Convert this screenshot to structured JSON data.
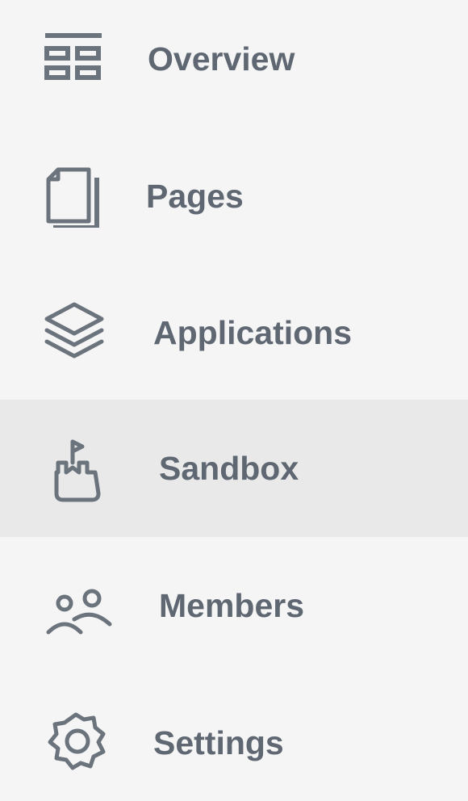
{
  "sidebar": {
    "colors": {
      "background": "#f5f5f5",
      "active_background": "#e9e9e9",
      "label": "#5f6772",
      "icon": "#6b737d"
    },
    "active_item": "Sandbox",
    "items": [
      {
        "label": "Overview",
        "icon": "dashboard-grid-icon"
      },
      {
        "label": "Pages",
        "icon": "pages-icon"
      },
      {
        "label": "Applications",
        "icon": "layers-icon"
      },
      {
        "label": "Sandbox",
        "icon": "sandcastle-flag-icon"
      },
      {
        "label": "Members",
        "icon": "members-icon"
      },
      {
        "label": "Settings",
        "icon": "gear-icon"
      }
    ]
  }
}
